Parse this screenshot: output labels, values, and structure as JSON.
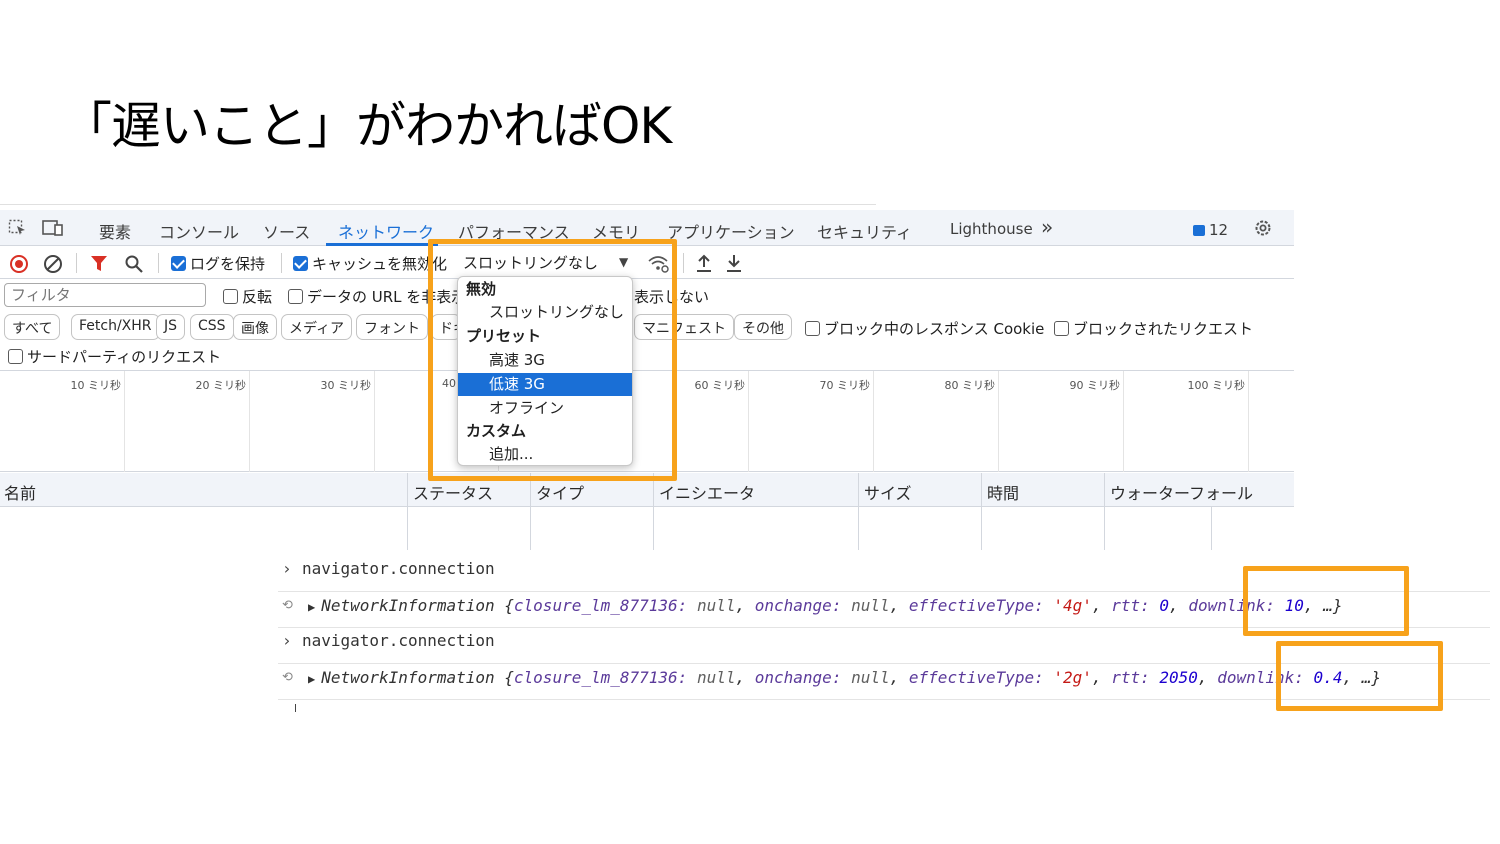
{
  "slide": {
    "title": "「遅いこと」がわかればOK"
  },
  "tabs": {
    "items": [
      "要素",
      "コンソール",
      "ソース",
      "ネットワーク",
      "パフォーマンス",
      "メモリ",
      "アプリケーション",
      "セキュリティ",
      "Lighthouse"
    ],
    "more": "»",
    "issues_count": "12",
    "active": "ネットワーク"
  },
  "toolbar": {
    "preserve_log": "ログを保持",
    "disable_cache": "キャッシュを無効化",
    "throttle_value": "スロットリングなし"
  },
  "filter": {
    "placeholder": "フィルタ",
    "invert": "反転",
    "hide_data_url": "データの URL を非表示",
    "hide_extension": "表示しない"
  },
  "chips": [
    "すべて",
    "Fetch/XHR",
    "JS",
    "CSS",
    "画像",
    "メディア",
    "フォント",
    "ドキ",
    "マニフェスト",
    "その他"
  ],
  "blocked": {
    "response_cookies": "ブロック中のレスポンス Cookie",
    "blocked_requests": "ブロックされたリクエスト",
    "third_party": "サードパーティのリクエスト"
  },
  "timeline": {
    "ticks": [
      "10 ミリ秒",
      "20 ミリ秒",
      "30 ミリ秒",
      "40",
      "60 ミリ秒",
      "70 ミリ秒",
      "80 ミリ秒",
      "90 ミリ秒",
      "100 ミリ秒"
    ]
  },
  "table": {
    "columns": [
      "名前",
      "ステータス",
      "タイプ",
      "イニシエータ",
      "サイズ",
      "時間",
      "ウォーターフォール"
    ]
  },
  "dropdown": {
    "group_disabled": "無効",
    "no_throttling": "スロットリングなし",
    "group_presets": "プリセット",
    "fast_3g": "高速 3G",
    "slow_3g": "低速 3G",
    "offline": "オフライン",
    "group_custom": "カスタム",
    "add": "追加...",
    "selected": "低速 3G"
  },
  "console": {
    "cmd1": "navigator.connection",
    "out1": {
      "name": "NetworkInformation",
      "closure_key": "closure_lm_877136:",
      "closure_val": "null",
      "onchange_key": "onchange:",
      "onchange_val": "null",
      "et_key": "effectiveType:",
      "et_val": "'4g'",
      "rtt_key": "rtt:",
      "rtt_val": "0",
      "dl_key": "downlink:",
      "dl_val": "10",
      "tail": "…}"
    },
    "cmd2": "navigator.connection",
    "out2": {
      "name": "NetworkInformation",
      "closure_key": "closure_lm_877136:",
      "closure_val": "null",
      "onchange_key": "onchange:",
      "onchange_val": "null",
      "et_key": "effectiveType:",
      "et_val": "'2g'",
      "rtt_key": "rtt:",
      "rtt_val": "2050",
      "dl_key": "downlink:",
      "dl_val": "0.4",
      "tail": "…}"
    }
  },
  "colors": {
    "accent": "#1a6fd6",
    "highlight": "#f7a21b",
    "record": "#d93025"
  }
}
